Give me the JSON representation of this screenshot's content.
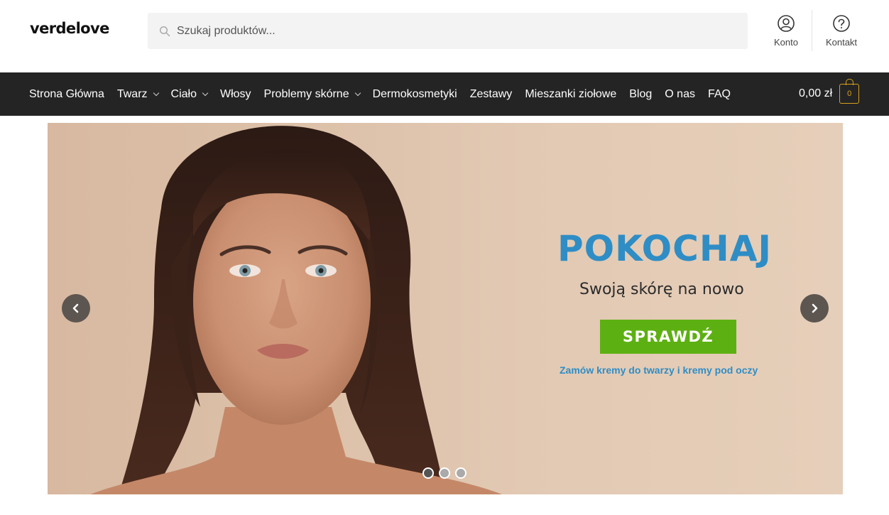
{
  "header": {
    "logo": "verdelove",
    "search_placeholder": "Szukaj produktów...",
    "account_label": "Konto",
    "contact_label": "Kontakt"
  },
  "nav": {
    "items": [
      {
        "label": "Strona Główna",
        "dropdown": false
      },
      {
        "label": "Twarz",
        "dropdown": true
      },
      {
        "label": "Ciało",
        "dropdown": true
      },
      {
        "label": "Włosy",
        "dropdown": false
      },
      {
        "label": "Problemy skórne",
        "dropdown": true
      },
      {
        "label": "Dermokosmetyki",
        "dropdown": false
      },
      {
        "label": "Zestawy",
        "dropdown": false
      },
      {
        "label": "Mieszanki ziołowe",
        "dropdown": false
      },
      {
        "label": "Blog",
        "dropdown": false
      },
      {
        "label": "O nas",
        "dropdown": false
      },
      {
        "label": "FAQ",
        "dropdown": false
      }
    ],
    "cart_amount": "0,00 zł",
    "cart_count": "0"
  },
  "hero": {
    "headline": "POKOCHAJ",
    "subline": "Swoją skórę na nowo",
    "cta_label": "SPRAWDŹ",
    "caption": "Zamów kremy do twarzy i kremy pod oczy",
    "slide_count": 3,
    "active_slide": 1
  },
  "colors": {
    "nav_bg": "#242424",
    "accent_blue": "#2f8dc5",
    "cta_green": "#5db012",
    "cart_gold": "#d8a01c"
  }
}
